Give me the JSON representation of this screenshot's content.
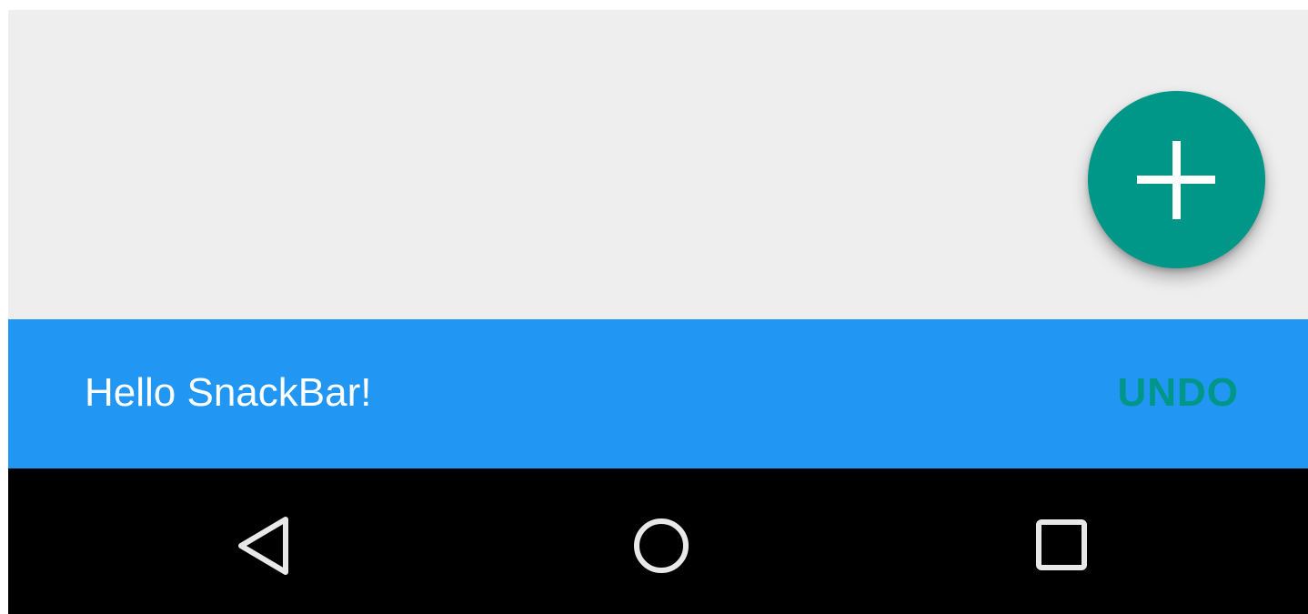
{
  "content": {
    "background_color": "#eeeeee"
  },
  "fab": {
    "icon": "plus-icon",
    "color": "#009688"
  },
  "snackbar": {
    "message": "Hello SnackBar!",
    "action_label": "UNDO",
    "background_color": "#2196f3",
    "action_color": "#009688"
  },
  "navbar": {
    "background_color": "#000000",
    "buttons": [
      {
        "icon": "back-triangle-icon"
      },
      {
        "icon": "home-circle-icon"
      },
      {
        "icon": "recents-square-icon"
      }
    ]
  }
}
